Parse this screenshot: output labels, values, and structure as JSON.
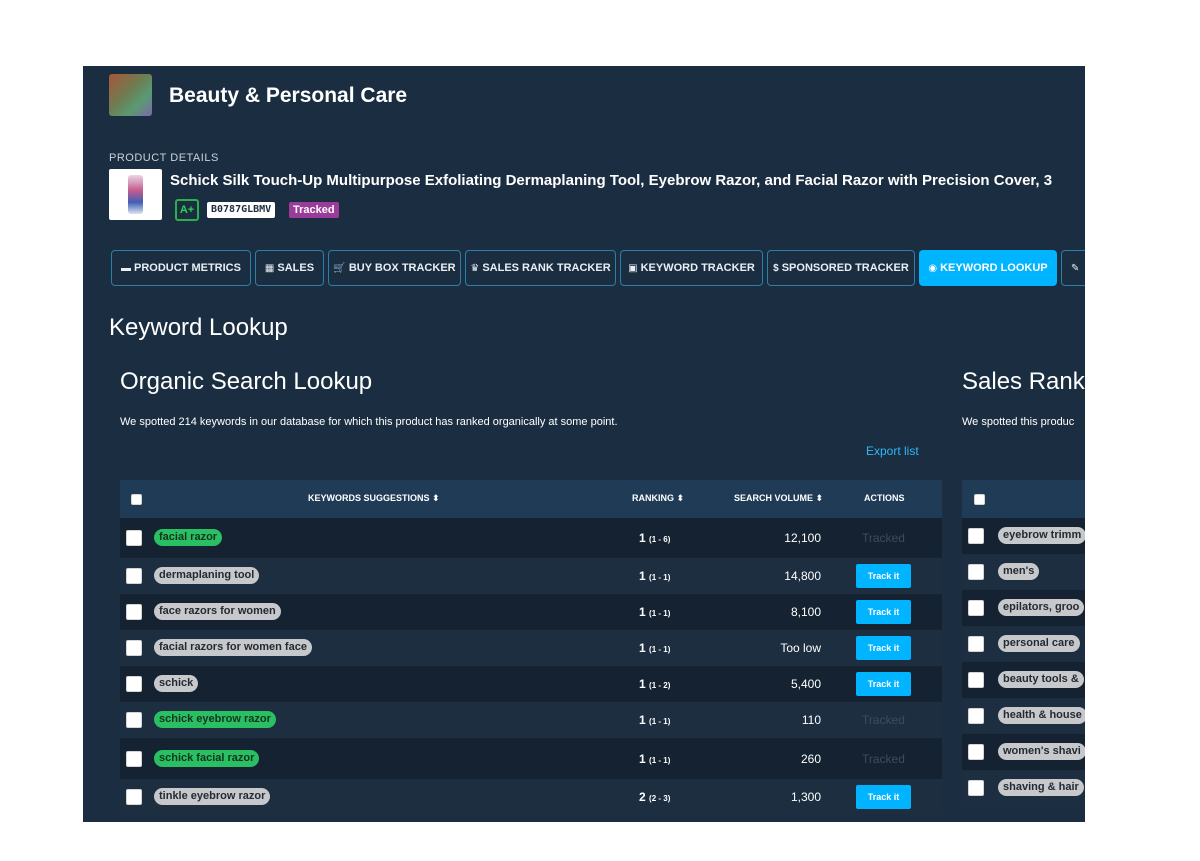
{
  "header": {
    "category_title": "Beauty & Personal Care"
  },
  "product": {
    "details_label": "PRODUCT DETAILS",
    "title": "Schick Silk Touch-Up Multipurpose Exfoliating Dermaplaning Tool, Eyebrow Razor, and Facial Razor with Precision Cover, 3",
    "grade": "A+",
    "asin": "B0787GLBMV",
    "status": "Tracked"
  },
  "tabs": [
    {
      "label": "PRODUCT METRICS",
      "icon": "chart-icon",
      "glyph": "▬"
    },
    {
      "label": "SALES",
      "icon": "money-icon",
      "glyph": "▦"
    },
    {
      "label": "BUY BOX TRACKER",
      "icon": "cart-icon",
      "glyph": "🛒"
    },
    {
      "label": "SALES RANK TRACKER",
      "icon": "trophy-icon",
      "glyph": "♛"
    },
    {
      "label": "KEYWORD TRACKER",
      "icon": "binoculars-icon",
      "glyph": "▣"
    },
    {
      "label": "SPONSORED TRACKER",
      "icon": "dollar-icon",
      "glyph": "$"
    },
    {
      "label": "KEYWORD LOOKUP",
      "icon": "eye-icon",
      "glyph": "◉"
    },
    {
      "label": "",
      "icon": "wrench-icon",
      "glyph": "✎"
    }
  ],
  "active_tab": "KEYWORD LOOKUP",
  "section_title": "Keyword Lookup",
  "organic": {
    "title": "Organic Search Lookup",
    "description": "We spotted 214 keywords in our database for which this product has ranked organically at some point.",
    "export_label": "Export list",
    "columns": {
      "keyword": "KEYWORDS SUGGESTIONS ⬍",
      "ranking": "RANKING ⬍",
      "volume": "SEARCH VOLUME ⬍",
      "actions": "ACTIONS"
    },
    "rows": [
      {
        "keyword": "facial razor",
        "tracked": true,
        "rank": "1",
        "range": "(1 - 6)",
        "volume": "12,100",
        "action": "Tracked"
      },
      {
        "keyword": "dermaplaning tool",
        "tracked": false,
        "rank": "1",
        "range": "(1 - 1)",
        "volume": "14,800",
        "action": "Track it"
      },
      {
        "keyword": "face razors for women",
        "tracked": false,
        "rank": "1",
        "range": "(1 - 1)",
        "volume": "8,100",
        "action": "Track it"
      },
      {
        "keyword": "facial razors for women face",
        "tracked": false,
        "rank": "1",
        "range": "(1 - 1)",
        "volume": "Too low",
        "action": "Track it"
      },
      {
        "keyword": "schick",
        "tracked": false,
        "rank": "1",
        "range": "(1 - 2)",
        "volume": "5,400",
        "action": "Track it"
      },
      {
        "keyword": "schick eyebrow razor",
        "tracked": true,
        "rank": "1",
        "range": "(1 - 1)",
        "volume": "110",
        "action": "Tracked"
      },
      {
        "keyword": "schick facial razor",
        "tracked": true,
        "rank": "1",
        "range": "(1 - 1)",
        "volume": "260",
        "action": "Tracked"
      },
      {
        "keyword": "tinkle eyebrow razor",
        "tracked": false,
        "rank": "2",
        "range": "(2 - 3)",
        "volume": "1,300",
        "action": "Track it"
      }
    ]
  },
  "sales_rank": {
    "title": "Sales Rank L",
    "description": "We spotted this produc",
    "rows": [
      "eyebrow trimm",
      "men's",
      "epilators, groo",
      "personal care",
      "beauty tools &",
      "health & house",
      "women's shavi",
      "shaving & hair"
    ]
  }
}
